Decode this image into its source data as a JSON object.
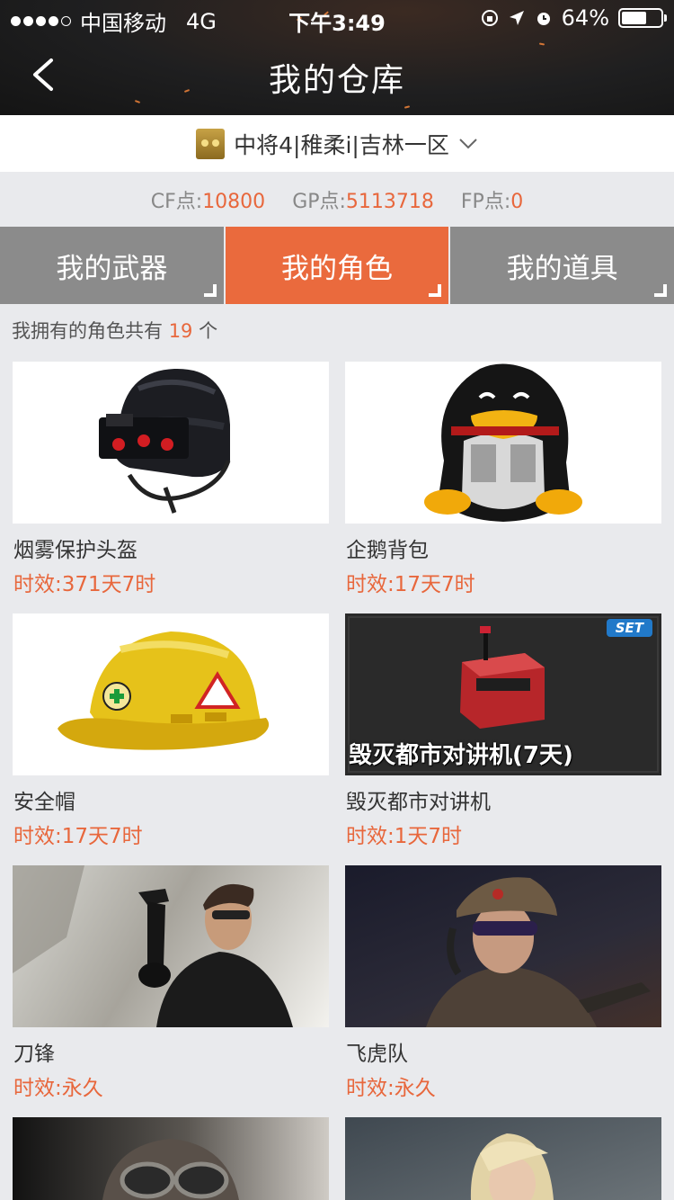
{
  "status_bar": {
    "carrier": "中国移动",
    "network": "4G",
    "time": "下午3:49",
    "battery": "64%",
    "battery_level": 0.64
  },
  "nav": {
    "title": "我的仓库",
    "back_icon": "chevron-left-icon"
  },
  "server": {
    "label": "中将4|稚柔i|吉林一区",
    "rank_icon": "rank-badge-icon",
    "dropdown_icon": "chevron-down-icon"
  },
  "points": {
    "cf_label": "CF点:",
    "cf_value": "10800",
    "gp_label": "GP点:",
    "gp_value": "5113718",
    "fp_label": "FP点:",
    "fp_value": "0"
  },
  "tabs": [
    {
      "label": "我的武器",
      "active": false
    },
    {
      "label": "我的角色",
      "active": true
    },
    {
      "label": "我的道具",
      "active": false
    }
  ],
  "summary": {
    "prefix": "我拥有的角色共有",
    "count": "19",
    "suffix": "个"
  },
  "items": [
    {
      "name": "烟雾保护头盔",
      "duration": "时效:371天7时",
      "image": "helmet-image"
    },
    {
      "name": "企鹅背包",
      "duration": "时效:17天7时",
      "image": "penguin-backpack-image"
    },
    {
      "name": "安全帽",
      "duration": "时效:17天7时",
      "image": "hardhat-image"
    },
    {
      "name": "毁灭都市对讲机",
      "duration": "时效:1天7时",
      "image": "walkie-talkie-image",
      "badge": "SET",
      "caption": "毁灭都市对讲机(7天)"
    },
    {
      "name": "刀锋",
      "duration": "时效:永久",
      "image": "blade-character-image"
    },
    {
      "name": "飞虎队",
      "duration": "时效:永久",
      "image": "flying-tiger-character-image"
    },
    {
      "name": "",
      "duration": "",
      "image": "goggles-character-image"
    },
    {
      "name": "",
      "duration": "",
      "image": "blonde-character-image"
    }
  ],
  "colors": {
    "accent": "#ea6a3d",
    "tab_inactive": "#8b8b8b",
    "page_bg": "#e9eaed"
  }
}
